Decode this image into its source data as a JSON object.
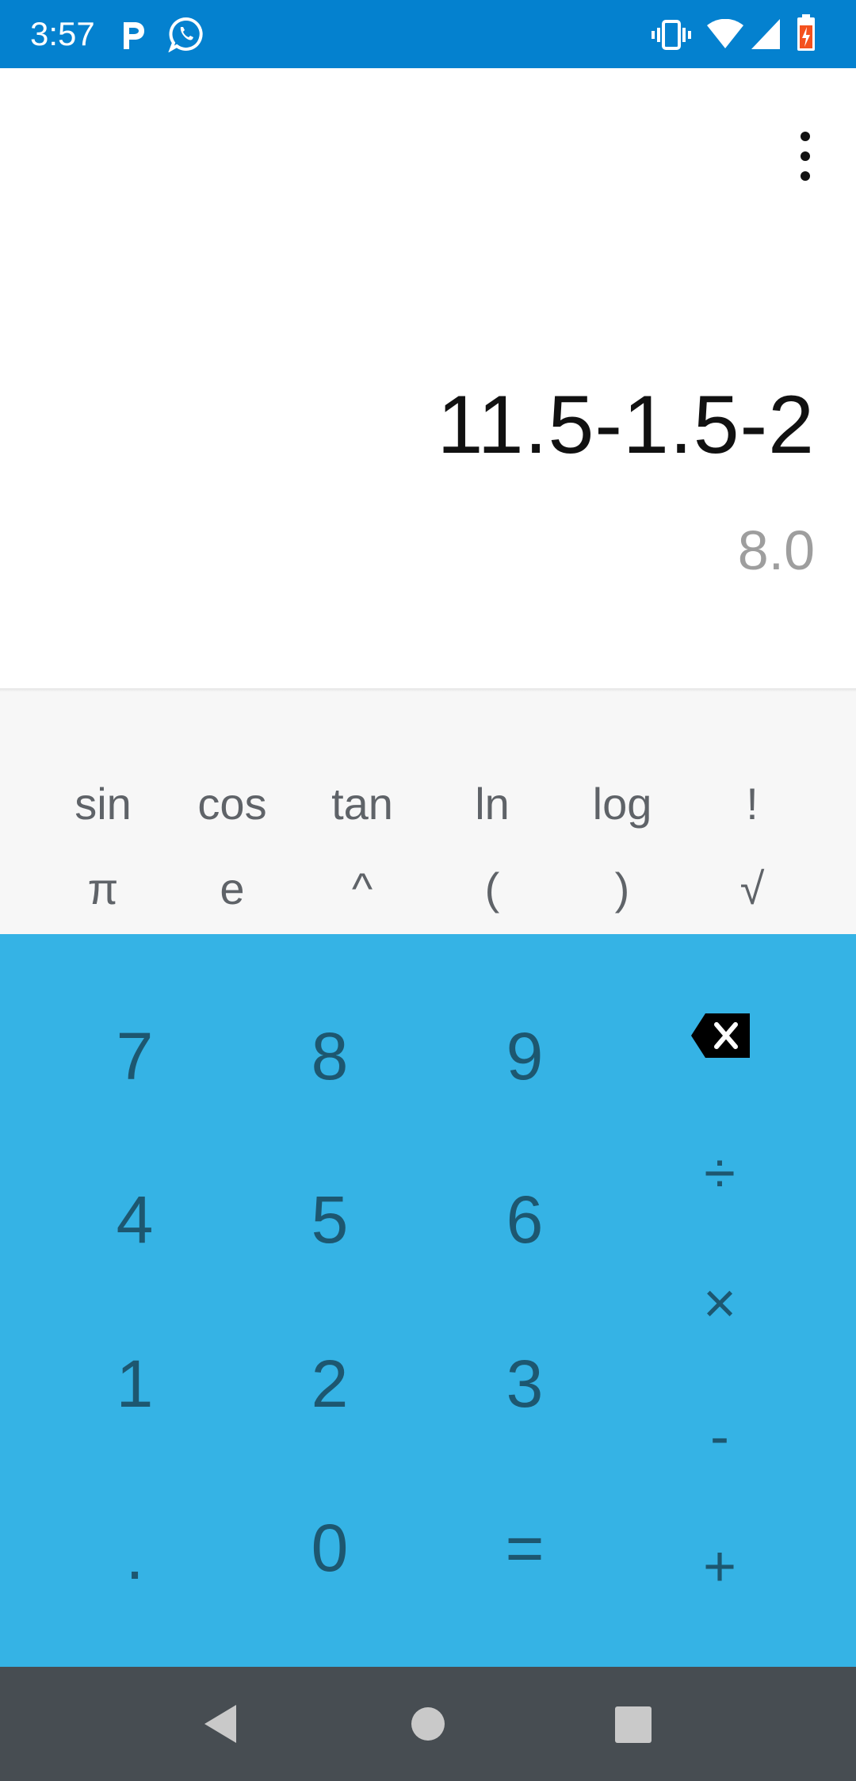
{
  "status_bar": {
    "time": "3:57",
    "left_icons": [
      "parking-icon",
      "whatsapp-icon"
    ],
    "right_icons": [
      "vibrate-icon",
      "wifi-icon",
      "cell-signal-icon",
      "battery-icon"
    ]
  },
  "display": {
    "expression": "11.5-1.5-2",
    "result": "8.0",
    "menu_icon": "more-vert-icon"
  },
  "scientific": {
    "row1": [
      "sin",
      "cos",
      "tan",
      "ln",
      "log",
      "!"
    ],
    "row2": [
      "π",
      "e",
      "^",
      "(",
      ")",
      "√"
    ]
  },
  "keypad": {
    "digits": {
      "k7": "7",
      "k8": "8",
      "k9": "9",
      "k4": "4",
      "k5": "5",
      "k6": "6",
      "k1": "1",
      "k2": "2",
      "k3": "3",
      "dot": ".",
      "k0": "0",
      "equals": "="
    },
    "operators": {
      "backspace_icon": "backspace-icon",
      "divide": "÷",
      "multiply": "×",
      "minus": "-",
      "plus": "+"
    }
  },
  "nav_bar": {
    "icons": [
      "back-icon",
      "home-icon",
      "recents-icon"
    ]
  },
  "colors": {
    "status_bar": "#0481CF",
    "scientific_panel": "#F7F7F7",
    "keypad": "#35B3E5",
    "key_text": "#1d5770",
    "nav_bar": "#474D52"
  }
}
